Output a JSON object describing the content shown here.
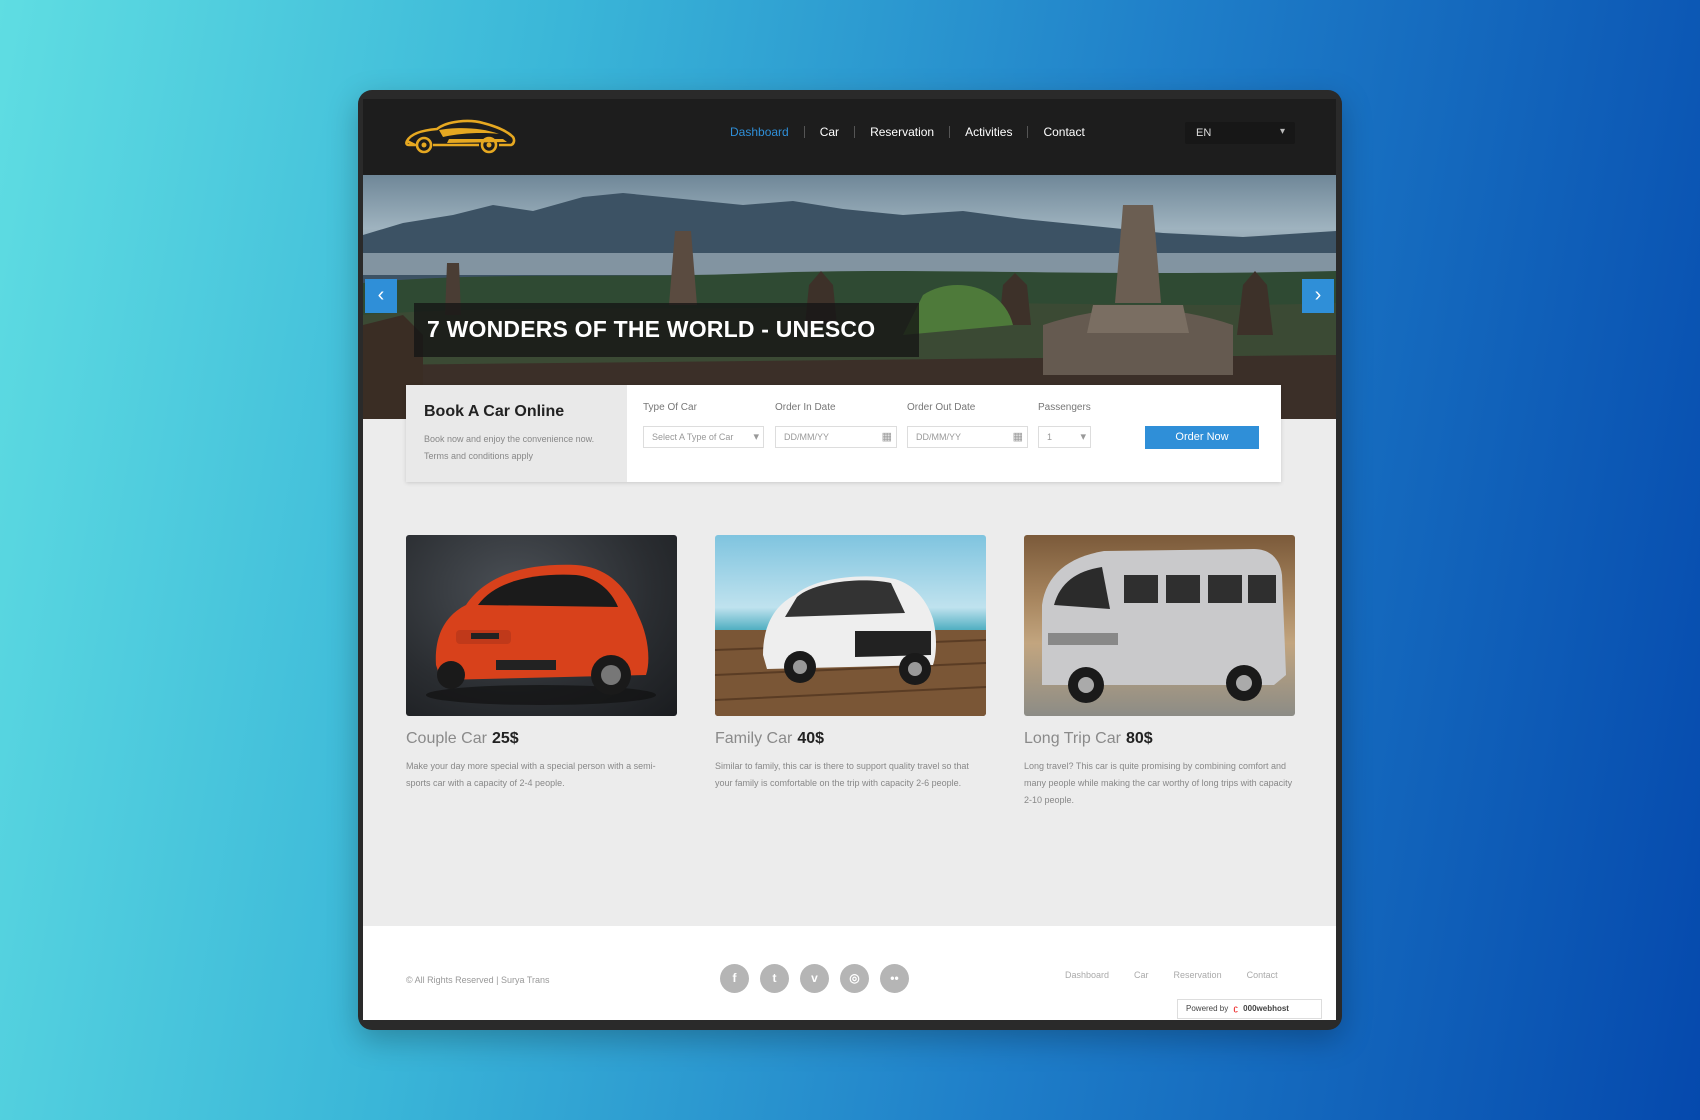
{
  "nav": {
    "items": [
      {
        "label": "Dashboard",
        "active": true
      },
      {
        "label": "Car"
      },
      {
        "label": "Reservation"
      },
      {
        "label": "Activities"
      },
      {
        "label": "Contact"
      }
    ],
    "language": "EN"
  },
  "hero": {
    "caption": "7 WONDERS OF THE WORLD - UNESCO"
  },
  "booking": {
    "title": "Book A Car Online",
    "description": "Book now and enjoy the convenience now. Terms and conditions apply",
    "fields": {
      "car_type": {
        "label": "Type Of Car",
        "value": "Select A Type of Car"
      },
      "in_date": {
        "label": "Order In Date",
        "placeholder": "DD/MM/YY"
      },
      "out_date": {
        "label": "Order Out Date",
        "placeholder": "DD/MM/YY"
      },
      "passengers": {
        "label": "Passengers",
        "value": "1"
      }
    },
    "submit": "Order Now"
  },
  "cars": [
    {
      "name": "Couple Car",
      "price": "25$",
      "description": "Make your day more special with a special person with a semi-sports car with a capacity of 2-4 people."
    },
    {
      "name": "Family Car",
      "price": "40$",
      "description": "Similar to family, this car is there to support quality travel so that your family is comfortable on the trip with capacity 2-6 people."
    },
    {
      "name": "Long Trip Car",
      "price": "80$",
      "description": "Long travel? This car is quite promising by combining comfort and many people while making the car worthy of long trips with capacity 2-10 people."
    }
  ],
  "footer": {
    "copyright": "© All Rights Reserved | Surya Trans",
    "social": [
      "f",
      "t",
      "v",
      "◎",
      "••"
    ],
    "links": [
      "Dashboard",
      "Car",
      "Reservation",
      "Contact"
    ],
    "powered": "Powered by",
    "host": "000webhost"
  },
  "colors": {
    "accent": "#2f8fd8",
    "nav_bg": "#1d1d1d",
    "logo": "#e6a821"
  }
}
